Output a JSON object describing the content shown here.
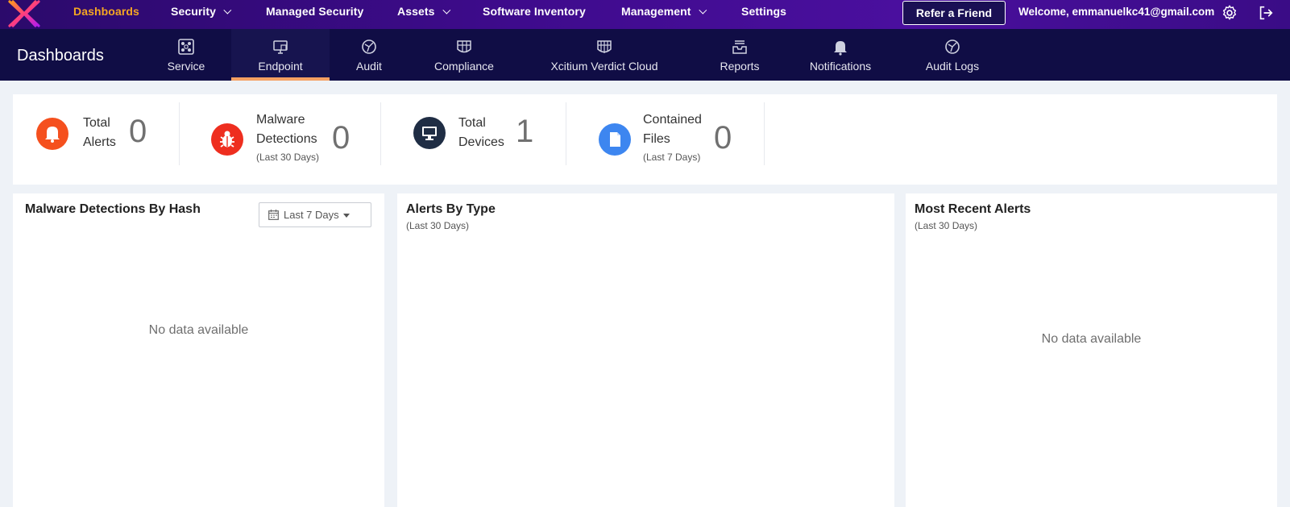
{
  "topnav": {
    "items": [
      {
        "label": "Dashboards"
      },
      {
        "label": "Security"
      },
      {
        "label": "Managed Security"
      },
      {
        "label": "Assets"
      },
      {
        "label": "Software Inventory"
      },
      {
        "label": "Management"
      },
      {
        "label": "Settings"
      }
    ],
    "refer_label": "Refer a Friend",
    "welcome": "Welcome, emmanuelkc41@gmail.com",
    "active_color": "#f5a623"
  },
  "subnav": {
    "title": "Dashboards",
    "tabs": [
      {
        "label": "Service",
        "icon": "service-icon"
      },
      {
        "label": "Endpoint",
        "icon": "monitor-icon"
      },
      {
        "label": "Audit",
        "icon": "audit-icon"
      },
      {
        "label": "Compliance",
        "icon": "compliance-grid-icon"
      },
      {
        "label": "Xcitium Verdict Cloud",
        "icon": "verdict-cloud-icon"
      },
      {
        "label": "Reports",
        "icon": "reports-icon"
      },
      {
        "label": "Notifications",
        "icon": "bell-icon"
      },
      {
        "label": "Audit Logs",
        "icon": "audit-logs-icon"
      }
    ],
    "active_tab": "Endpoint"
  },
  "stats": [
    {
      "label_line1": "Total",
      "label_line2": "Alerts",
      "sub": "",
      "value": "0",
      "color": "#f5501e",
      "icon": "bell-icon"
    },
    {
      "label_line1": "Malware",
      "label_line2": "Detections",
      "sub": "(Last 30 Days)",
      "value": "0",
      "color": "#ee2e1f",
      "icon": "bug-icon"
    },
    {
      "label_line1": "Total",
      "label_line2": "Devices",
      "sub": "",
      "value": "1",
      "color": "#1f2d44",
      "icon": "monitor-icon"
    },
    {
      "label_line1": "Contained",
      "label_line2": "Files",
      "sub": "(Last 7 Days)",
      "value": "0",
      "color": "#3d86f0",
      "icon": "file-icon"
    }
  ],
  "panels": {
    "malware": {
      "title": "Malware Detections By Hash",
      "filter": "Last 7 Days",
      "empty": "No data available"
    },
    "alerts_by_type": {
      "title": "Alerts By Type",
      "sub": "(Last 30 Days)"
    },
    "recent_alerts": {
      "title": "Most Recent Alerts",
      "sub": "(Last 30 Days)",
      "empty": "No data available"
    }
  }
}
